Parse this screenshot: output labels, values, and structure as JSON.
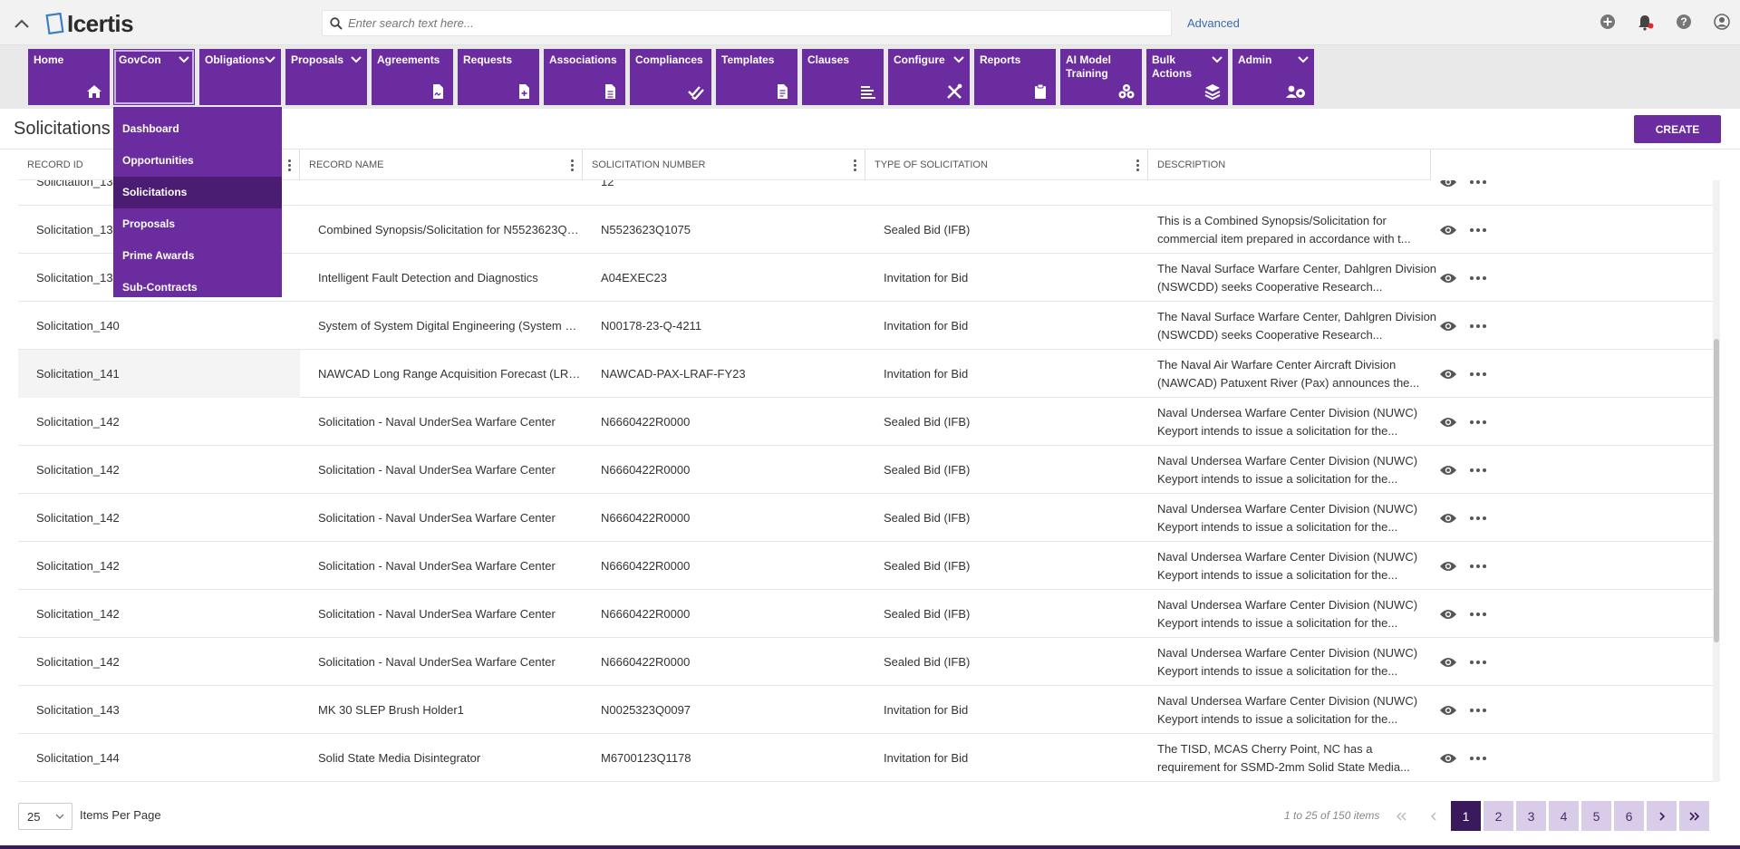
{
  "header": {
    "logo_text": "Icertis",
    "search_placeholder": "Enter search text here...",
    "advanced_label": "Advanced"
  },
  "nav": {
    "items": [
      {
        "label": "Home",
        "icon": "home-icon",
        "has_chevron": false
      },
      {
        "label": "GovCon",
        "icon": "",
        "has_chevron": true
      },
      {
        "label": "Obligations",
        "icon": "",
        "has_chevron": true
      },
      {
        "label": "Proposals",
        "icon": "",
        "has_chevron": true
      },
      {
        "label": "Agreements",
        "icon": "agreement-doc-icon",
        "has_chevron": false
      },
      {
        "label": "Requests",
        "icon": "request-add-icon",
        "has_chevron": false
      },
      {
        "label": "Associations",
        "icon": "document-icon",
        "has_chevron": false
      },
      {
        "label": "Compliances",
        "icon": "double-check-icon",
        "has_chevron": false
      },
      {
        "label": "Templates",
        "icon": "template-doc-icon",
        "has_chevron": false
      },
      {
        "label": "Clauses",
        "icon": "text-lines-icon",
        "has_chevron": false
      },
      {
        "label": "Configure",
        "icon": "tools-icon",
        "has_chevron": true
      },
      {
        "label": "Reports",
        "icon": "clipboard-icon",
        "has_chevron": false
      },
      {
        "label": "AI Model Training",
        "icon": "ai-cubes-icon",
        "has_chevron": false
      },
      {
        "label": "Bulk Actions",
        "icon": "layers-icon",
        "has_chevron": true
      },
      {
        "label": "Admin",
        "icon": "users-gear-icon",
        "has_chevron": true
      }
    ],
    "govcon_dropdown": [
      "Dashboard",
      "Opportunities",
      "Solicitations",
      "Proposals",
      "Prime Awards",
      "Sub-Contracts"
    ],
    "govcon_selected": "Solicitations"
  },
  "page": {
    "title": "Solicitations",
    "create_label": "CREATE"
  },
  "table": {
    "columns": [
      "RECORD ID",
      "RECORD NAME",
      "SOLICITATION NUMBER",
      "TYPE OF SOLICITATION",
      "DESCRIPTION"
    ],
    "rows": [
      {
        "id": "Solicitation_13",
        "name": "",
        "number": "12",
        "type": "",
        "desc": ""
      },
      {
        "id": "Solicitation_13",
        "name": "Combined Synopsis/Solicitation for N5523623Q0...",
        "number": "N5523623Q1075",
        "type": "Sealed Bid (IFB)",
        "desc": "This is a Combined Synopsis/Solicitation for commercial item prepared in accordance with t..."
      },
      {
        "id": "Solicitation_13",
        "name": "Intelligent Fault Detection and Diagnostics",
        "number": "A04EXEC23",
        "type": "Invitation for Bid",
        "desc": "The Naval Surface Warfare Center, Dahlgren Division (NSWCDD) seeks Cooperative Research..."
      },
      {
        "id": "Solicitation_140",
        "name": "System of System Digital Engineering (System Mo...",
        "number": "N00178-23-Q-4211",
        "type": "Invitation for Bid",
        "desc": "The Naval Surface Warfare Center, Dahlgren Division (NSWCDD) seeks Cooperative Research..."
      },
      {
        "id": "Solicitation_141",
        "name": "NAWCAD Long Range Acquisition Forecast (LRAF) ...",
        "number": "NAWCAD-PAX-LRAF-FY23",
        "type": "Invitation for Bid",
        "desc": "The Naval Air Warfare Center Aircraft Division (NAWCAD) Patuxent River (Pax) announces the..."
      },
      {
        "id": "Solicitation_142",
        "name": "Solicitation - Naval UnderSea Warfare Center",
        "number": "N6660422R0000",
        "type": "Sealed Bid (IFB)",
        "desc": "Naval Undersea Warfare Center Division (NUWC) Keyport intends to issue a solicitation for the..."
      },
      {
        "id": "Solicitation_142",
        "name": "Solicitation - Naval UnderSea Warfare Center",
        "number": "N6660422R0000",
        "type": "Sealed Bid (IFB)",
        "desc": "Naval Undersea Warfare Center Division (NUWC) Keyport intends to issue a solicitation for the..."
      },
      {
        "id": "Solicitation_142",
        "name": "Solicitation - Naval UnderSea Warfare Center",
        "number": "N6660422R0000",
        "type": "Sealed Bid (IFB)",
        "desc": "Naval Undersea Warfare Center Division (NUWC) Keyport intends to issue a solicitation for the..."
      },
      {
        "id": "Solicitation_142",
        "name": "Solicitation - Naval UnderSea Warfare Center",
        "number": "N6660422R0000",
        "type": "Sealed Bid (IFB)",
        "desc": "Naval Undersea Warfare Center Division (NUWC) Keyport intends to issue a solicitation for the..."
      },
      {
        "id": "Solicitation_142",
        "name": "Solicitation - Naval UnderSea Warfare Center",
        "number": "N6660422R0000",
        "type": "Sealed Bid (IFB)",
        "desc": "Naval Undersea Warfare Center Division (NUWC) Keyport intends to issue a solicitation for the..."
      },
      {
        "id": "Solicitation_142",
        "name": "Solicitation - Naval UnderSea Warfare Center",
        "number": "N6660422R0000",
        "type": "Sealed Bid (IFB)",
        "desc": "Naval Undersea Warfare Center Division (NUWC) Keyport intends to issue a solicitation for the..."
      },
      {
        "id": "Solicitation_143",
        "name": "MK 30 SLEP Brush Holder1",
        "number": "N0025323Q0097",
        "type": "Invitation for Bid",
        "desc": "Naval Undersea Warfare Center Division (NUWC) Keyport intends to issue a solicitation for the..."
      },
      {
        "id": "Solicitation_144",
        "name": "Solid State Media Disintegrator",
        "number": "M6700123Q1178",
        "type": "Invitation for Bid",
        "desc": "The TISD, MCAS Cherry Point, NC has a requirement for SSMD-2mm Solid State Media..."
      }
    ]
  },
  "footer": {
    "per_page_value": "25",
    "per_page_label": "Items Per Page",
    "page_info": "1 to 25 of 150 items",
    "pages": [
      "1",
      "2",
      "3",
      "4",
      "5",
      "6"
    ],
    "current_page": "1"
  },
  "colors": {
    "brand_purple": "#6a2c9e",
    "selected_purple": "#4a1d73",
    "page_current": "#3a1a5c"
  }
}
